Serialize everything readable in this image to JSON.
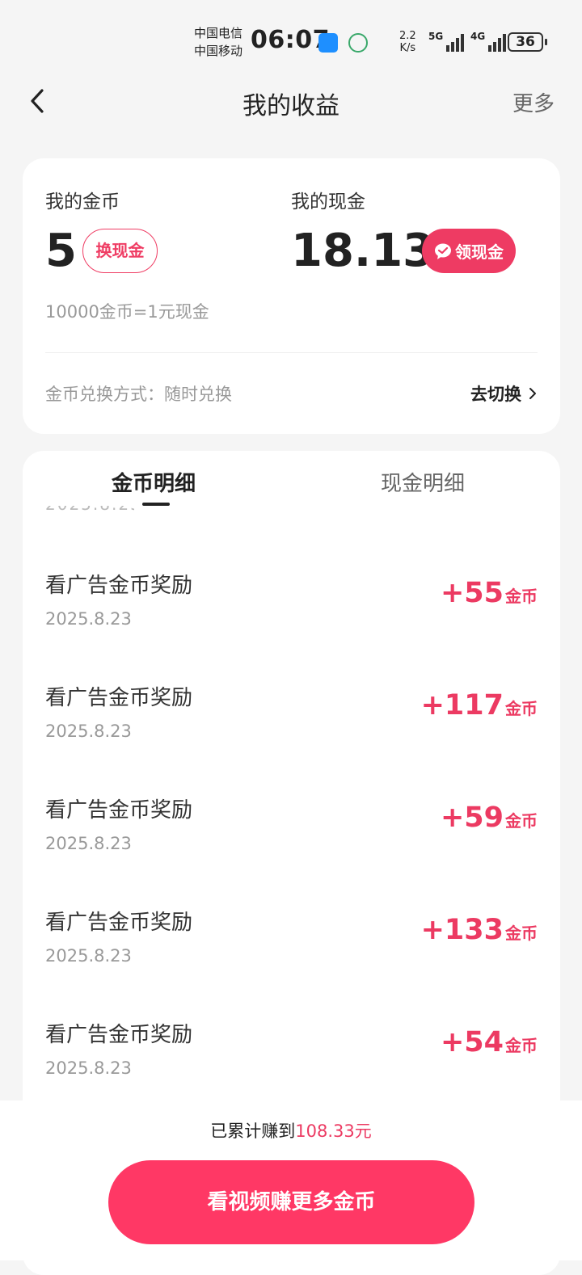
{
  "status_bar": {
    "carrier1": "中国电信",
    "carrier2": "中国移动",
    "time": "06:07",
    "speed_top": "2.2",
    "speed_bottom": "K/s",
    "sig1_label": "5G",
    "sig2_label": "4G",
    "battery": "36"
  },
  "header": {
    "title": "我的收益",
    "more": "更多"
  },
  "summary": {
    "gold_label": "我的金币",
    "gold_value": "5",
    "exchange_btn": "换现金",
    "cash_label": "我的现金",
    "cash_value": "18.13",
    "claim_btn": "领现金",
    "rate": "10000金币=1元现金",
    "method": "金币兑换方式：随时兑换",
    "switch": "去切换"
  },
  "tabs": {
    "gold": "金币明细",
    "cash": "现金明细"
  },
  "records": [
    {
      "title": "看广告金币奖励",
      "date": "2025.8.23",
      "amount": "+55",
      "unit": "金币"
    },
    {
      "title": "看广告金币奖励",
      "date": "2025.8.23",
      "amount": "+117",
      "unit": "金币"
    },
    {
      "title": "看广告金币奖励",
      "date": "2025.8.23",
      "amount": "+59",
      "unit": "金币"
    },
    {
      "title": "看广告金币奖励",
      "date": "2025.8.23",
      "amount": "+133",
      "unit": "金币"
    },
    {
      "title": "看广告金币奖励",
      "date": "2025.8.23",
      "amount": "+54",
      "unit": "金币"
    }
  ],
  "footer": {
    "total_prefix": "已累计赚到",
    "total_value": "108.33元",
    "cta": "看视频赚更多金币"
  },
  "colors": {
    "accent": "#ec3a62",
    "cta": "#ff3865"
  }
}
